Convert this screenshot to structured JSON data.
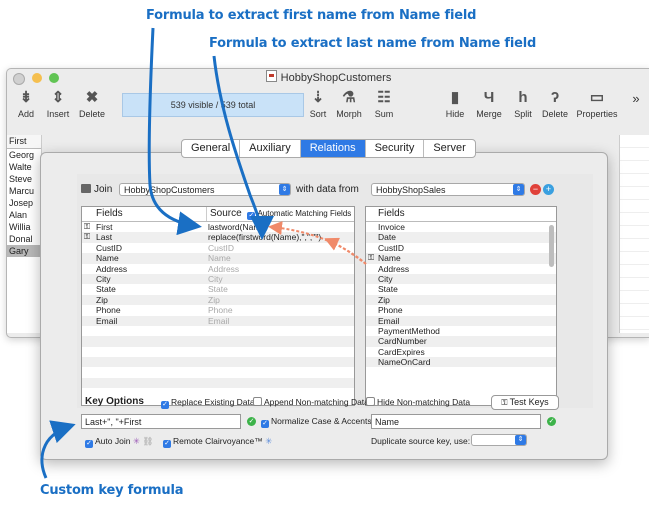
{
  "annotations": {
    "first_formula": "Formula to extract first name from Name field",
    "last_formula": "Formula to extract last name from Name field",
    "custom_key": "Custom key formula"
  },
  "window": {
    "title": "HobbyShopCustomers"
  },
  "toolbar": {
    "add": "Add",
    "insert": "Insert",
    "delete": "Delete",
    "status": "539 visible / 539 total",
    "sort": "Sort",
    "morph": "Morph",
    "sum": "Sum",
    "hide": "Hide",
    "merge": "Merge",
    "split": "Split",
    "delete2": "Delete",
    "properties": "Properties",
    "more": "»"
  },
  "left_list": {
    "header": "First",
    "items": [
      "Georg",
      "Walte",
      "Steve",
      "Marcu",
      "Josep",
      "Alan",
      "Willia",
      "Donal",
      "Gary"
    ]
  },
  "tabs": [
    "General",
    "Auxiliary",
    "Relations",
    "Security",
    "Server"
  ],
  "join": {
    "label": "Join",
    "db": "HobbyShopCustomers",
    "with_label": "with data from",
    "source_db": "HobbyShopSales"
  },
  "fields_table": {
    "col_fields": "Fields",
    "col_source": "Source",
    "auto_label": "Automatic Matching Fields",
    "rows": [
      {
        "field": "First",
        "source": "lastword(Name)",
        "key": true,
        "gray": false
      },
      {
        "field": "Last",
        "source": "replace(firstword(Name),\",\",\"\")",
        "key": true,
        "gray": false
      },
      {
        "field": "CustID",
        "source": "CustID",
        "key": false,
        "gray": true
      },
      {
        "field": "Name",
        "source": "Name",
        "key": false,
        "gray": true
      },
      {
        "field": "Address",
        "source": "Address",
        "key": false,
        "gray": true
      },
      {
        "field": "City",
        "source": "City",
        "key": false,
        "gray": true
      },
      {
        "field": "State",
        "source": "State",
        "key": false,
        "gray": true
      },
      {
        "field": "Zip",
        "source": "Zip",
        "key": false,
        "gray": true
      },
      {
        "field": "Phone",
        "source": "Phone",
        "key": false,
        "gray": true
      },
      {
        "field": "Email",
        "source": "Email",
        "key": false,
        "gray": true
      }
    ]
  },
  "source_fields": {
    "header": "Fields",
    "items": [
      "Invoice",
      "Date",
      "CustID",
      "Name",
      "Address",
      "City",
      "State",
      "Zip",
      "Phone",
      "Email",
      "PaymentMethod",
      "CardNumber",
      "CardExpires",
      "NameOnCard"
    ]
  },
  "key_options": {
    "title": "Key Options",
    "replace": "Replace Existing Data",
    "append": "Append Non-matching Data",
    "hide": "Hide Non-matching Data",
    "test_keys": "Test Keys",
    "formula": "Last+\", \"+First",
    "normalize": "Normalize Case & Accents",
    "source_key": "Name",
    "auto_join": "Auto Join",
    "clairvoyance": "Remote Clairvoyance™",
    "duplicate": "Duplicate source key, use:"
  },
  "colors": {
    "accent": "#2f7ae5",
    "annotation": "#1a6fc4",
    "link_arrow": "#f08a6a",
    "ok": "#3db34a",
    "remove": "#e0413a",
    "add": "#3aa0e0"
  }
}
